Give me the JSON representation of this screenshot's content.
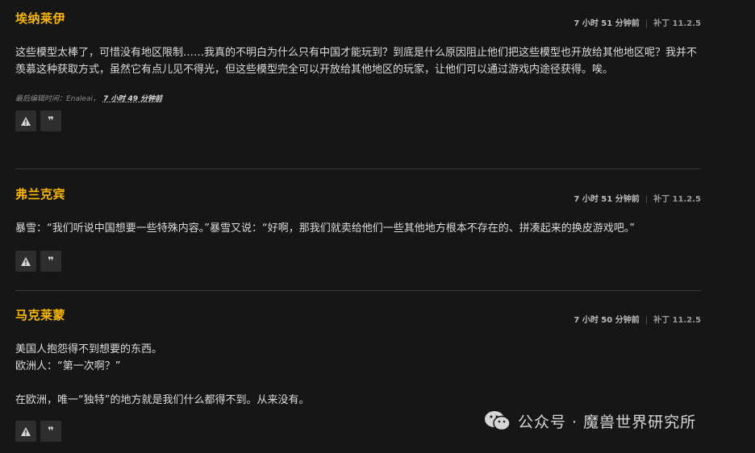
{
  "comments": [
    {
      "author": "埃纳莱伊",
      "time": "7 小时 51 分钟前",
      "patch": "补丁 11.2.5",
      "paragraphs": [
        "这些模型太棒了，可惜没有地区限制……我真的不明白为什么只有中国才能玩到？到底是什么原因阻止他们把这些模型也开放给其他地区呢？我并不羡慕这种获取方式，虽然它有点儿见不得光，但这些模型完全可以开放给其他地区的玩家，让他们可以通过游戏内途径获得。唉。"
      ],
      "edited_label": "最后编辑时间：Enaleai，",
      "edited_time": "7 小时 49 分钟前"
    },
    {
      "author": "弗兰克宾",
      "time": "7 小时 51 分钟前",
      "patch": "补丁 11.2.5",
      "paragraphs": [
        "暴雪：“我们听说中国想要一些特殊内容。”暴雪又说：“好啊，那我们就卖给他们一些其他地方根本不存在的、拼凑起来的换皮游戏吧。”"
      ]
    },
    {
      "author": "马克莱蒙",
      "time": "7 小时 50 分钟前",
      "patch": "补丁 11.2.5",
      "lines": [
        "美国人抱怨得不到想要的东西。",
        "欧洲人：“第一次啊？”",
        "在欧洲，唯一“独特”的地方就是我们什么都得不到。从来没有。"
      ]
    }
  ],
  "actions": {
    "report_icon": "warning-triangle-icon",
    "quote_icon": "quote-icon",
    "quote_glyph": "❞"
  },
  "watermark": {
    "text": "公众号 · 魔兽世界研究所"
  },
  "colors": {
    "background": "#161616",
    "author": "#f8b700",
    "text": "#dcdcdc",
    "button": "#2e2e2e"
  }
}
